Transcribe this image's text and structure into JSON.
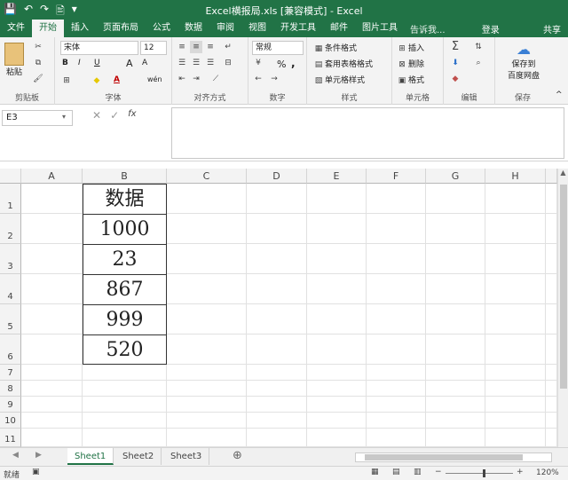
{
  "window": {
    "title": "Excel横报局.xls [兼容模式] - Excel"
  },
  "qat": {
    "save": "💾",
    "undo": "↶",
    "redo": "↷",
    "preview": "🖹",
    "customize": "▾"
  },
  "tabs": [
    "文件",
    "开始",
    "插入",
    "页面布局",
    "公式",
    "数据",
    "审阅",
    "视图",
    "开发工具",
    "邮件",
    "图片工具"
  ],
  "active_tab": "开始",
  "tell_me": "告诉我...",
  "login": "登录",
  "share": "共享",
  "ribbon": {
    "clipboard": {
      "title": "剪贴板",
      "paste": "粘贴"
    },
    "font": {
      "title": "字体",
      "name": "宋体",
      "size": "12",
      "bold": "B",
      "italic": "I",
      "underline": "U",
      "grow": "A",
      "shrink": "A",
      "color": "A",
      "wen": "wén"
    },
    "alignment": {
      "title": "对齐方式"
    },
    "number": {
      "title": "数字",
      "format": "常规",
      "percent": "%",
      "comma": ","
    },
    "styles": {
      "title": "样式",
      "conditional": "条件格式",
      "table": "套用表格格式",
      "cell": "单元格样式"
    },
    "cells": {
      "title": "单元格",
      "insert": "插入",
      "delete": "删除",
      "format": "格式"
    },
    "editing": {
      "title": "编辑"
    },
    "save": {
      "title": "保存",
      "label1": "保存到",
      "label2": "百度网盘"
    }
  },
  "formula_bar": {
    "cell_ref": "E3",
    "fx": "fx"
  },
  "columns": [
    "A",
    "B",
    "C",
    "D",
    "E",
    "F",
    "G",
    "H"
  ],
  "rows": [
    "1",
    "2",
    "3",
    "4",
    "5",
    "6",
    "7",
    "8",
    "9",
    "10",
    "11"
  ],
  "cells_B": [
    "数据",
    "1000",
    "23",
    "867",
    "999",
    "520"
  ],
  "sheets": [
    "Sheet1",
    "Sheet2",
    "Sheet3"
  ],
  "active_sheet": "Sheet1",
  "status": {
    "ready": "就绪",
    "zoom": "120%"
  }
}
